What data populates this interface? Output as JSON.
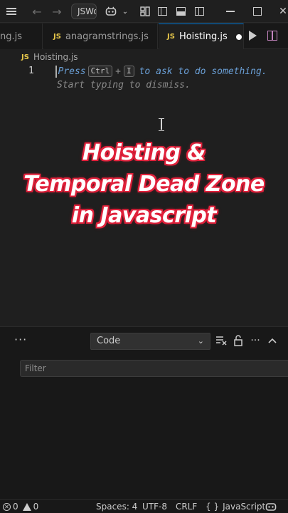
{
  "titlebar": {
    "search_text": "JSWorkspace",
    "icons": [
      "menu-icon",
      "arrow-back-icon",
      "arrow-forward-icon",
      "copilot-icon",
      "chevron-down-icon",
      "customize-layout-icon",
      "toggle-sidebar-icon",
      "toggle-panel-icon",
      "toggle-secondary-sidebar-icon",
      "minimize-icon",
      "maximize-icon",
      "close-icon"
    ]
  },
  "tabs": [
    {
      "label": "ng.js",
      "active": false
    },
    {
      "label": "anagramstrings.js",
      "active": false
    },
    {
      "label": "Hoisting.js",
      "active": true,
      "dirty": true
    }
  ],
  "file_badge": "JS",
  "breadcrumb": {
    "file": "Hoisting.js"
  },
  "editor": {
    "line_number": "1",
    "hint": {
      "press": "Press",
      "key1": "Ctrl",
      "plus": "+",
      "key2": "I",
      "rest": "to ask to do something.",
      "line2": "Start typing to dismiss."
    }
  },
  "overlay": {
    "line1": "Hoisting &",
    "line2": "Temporal Dead Zone",
    "line3": "in Javascript",
    "stroke_color": "#e0203a"
  },
  "panel": {
    "more": "···",
    "output_channel": "Code",
    "filter_placeholder": "Filter"
  },
  "statusbar": {
    "errors": "0",
    "warnings": "0",
    "spaces": "Spaces: 4",
    "encoding": "UTF-8",
    "eol": "CRLF",
    "language_brace": "{ }",
    "language": "JavaScript"
  }
}
